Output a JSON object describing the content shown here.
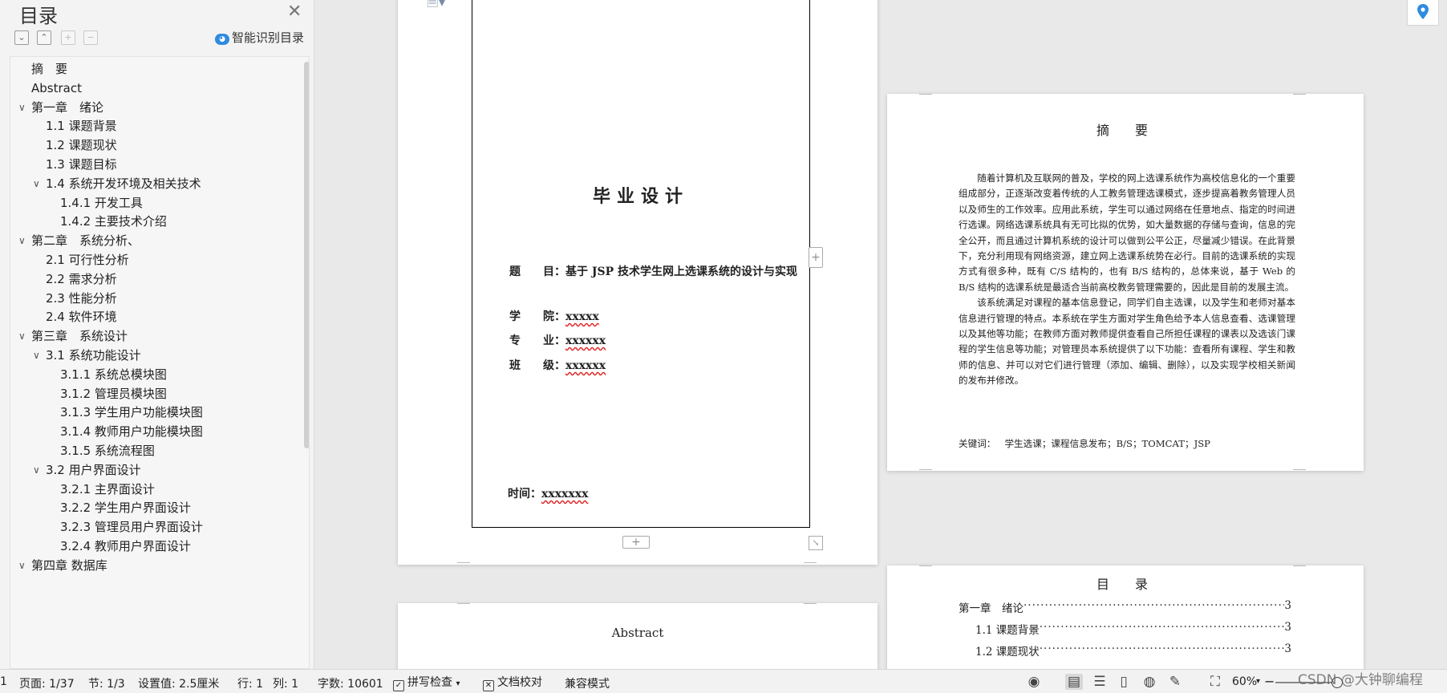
{
  "sidebar": {
    "title": "目录",
    "ai_toc_label": "智能识别目录",
    "ai_toc_icon": "cloud-ai-icon",
    "items": [
      {
        "label": "摘　要",
        "level": 0,
        "expanded": null
      },
      {
        "label": "Abstract",
        "level": 0,
        "expanded": null
      },
      {
        "label": "第一章　绪论",
        "level": 0,
        "expanded": true
      },
      {
        "label": "1.1 课题背景",
        "level": 1,
        "expanded": null
      },
      {
        "label": "1.2 课题现状",
        "level": 1,
        "expanded": null
      },
      {
        "label": "1.3 课题目标",
        "level": 1,
        "expanded": null
      },
      {
        "label": "1.4 系统开发环境及相关技术",
        "level": 1,
        "expanded": true
      },
      {
        "label": "1.4.1  开发工具",
        "level": 2,
        "expanded": null
      },
      {
        "label": "1.4.2 主要技术介绍",
        "level": 2,
        "expanded": null
      },
      {
        "label": "第二章　系统分析、",
        "level": 0,
        "expanded": true
      },
      {
        "label": "2.1 可行性分析",
        "level": 1,
        "expanded": null
      },
      {
        "label": "2.2 需求分析",
        "level": 1,
        "expanded": null
      },
      {
        "label": "2.3 性能分析",
        "level": 1,
        "expanded": null
      },
      {
        "label": "2.4 软件环境",
        "level": 1,
        "expanded": null
      },
      {
        "label": "第三章　系统设计",
        "level": 0,
        "expanded": true
      },
      {
        "label": "3.1 系统功能设计",
        "level": 1,
        "expanded": true
      },
      {
        "label": "3.1.1 系统总模块图",
        "level": 2,
        "expanded": null
      },
      {
        "label": "3.1.2 管理员模块图",
        "level": 2,
        "expanded": null
      },
      {
        "label": "3.1.3 学生用户功能模块图",
        "level": 2,
        "expanded": null
      },
      {
        "label": "3.1.4 教师用户功能模块图",
        "level": 2,
        "expanded": null
      },
      {
        "label": "3.1.5 系统流程图",
        "level": 2,
        "expanded": null
      },
      {
        "label": "3.2 用户界面设计",
        "level": 1,
        "expanded": true
      },
      {
        "label": "3.2.1 主界面设计",
        "level": 2,
        "expanded": null
      },
      {
        "label": "3.2.2 学生用户界面设计",
        "level": 2,
        "expanded": null
      },
      {
        "label": "3.2.3 管理员用户界面设计",
        "level": 2,
        "expanded": null
      },
      {
        "label": "3.2.4 教师用户界面设计",
        "level": 2,
        "expanded": null
      },
      {
        "label": "第四章  数据库",
        "level": 0,
        "expanded": true
      }
    ]
  },
  "cover": {
    "title": "毕业设计",
    "topic_label": "题　　目：",
    "topic_value": "基于 JSP 技术学生网上选课系统的设计与实现",
    "college_label": "学　　院：",
    "college_value": "xxxxx",
    "major_label": "专　　业：",
    "major_value": "xxxxxx",
    "class_label": "班　　级：",
    "class_value": "xxxxxx",
    "time_label": "时间：",
    "time_value": "xxxxxxx"
  },
  "abstract_cn": {
    "title": "摘　要",
    "p1": "随着计算机及互联网的普及，学校的网上选课系统作为高校信息化的一个重要组成部分，正逐渐改变着传统的人工教务管理选课模式，逐步提高着教务管理人员以及师生的工作效率。应用此系统，学生可以通过网络在任意地点、指定的时间进行选课。网络选课系统具有无可比拟的优势，如大量数据的存储与查询，信息的完全公开，而且通过计算机系统的设计可以做到公平公正，尽量减少错误。在此背景下，充分利用现有网络资源，建立网上选课系统势在必行。目前的选课系统的实现方式有很多种，既有 C/S 结构的，也有 B/S 结构的，总体来说，基于 Web 的 B/S 结构的选课系统是最适合当前高校教务管理需要的，因此是目前的发展主流。",
    "p2": "该系统满足对课程的基本信息登记，同学们自主选课，以及学生和老师对基本信息进行管理的特点。本系统在学生方面对学生角色给予本人信息查看、选课管理以及其他等功能；在教师方面对教师提供查看自己所担任课程的课表以及选该门课程的学生信息等功能；对管理员本系统提供了以下功能：查看所有课程、学生和教师的信息、并可以对它们进行管理（添加、编辑、删除），以及实现学校相关新闻的发布并修改。",
    "keywords_label": "关键词：",
    "keywords_value": "学生选课；课程信息发布；B/S；TOMCAT；JSP"
  },
  "abstract_en": {
    "title": "Abstract"
  },
  "toc_page": {
    "title": "目　录",
    "lines": [
      {
        "label": "第一章　绪论",
        "page": "3",
        "indent": 0
      },
      {
        "label": "1.1 课题背景",
        "page": "3",
        "indent": 1
      },
      {
        "label": "1.2 课题现状",
        "page": "3",
        "indent": 1
      }
    ]
  },
  "statusbar": {
    "page": "页面: 1/37",
    "section": "节: 1/3",
    "setting": "设置值: 2.5厘米",
    "row": "行: 1",
    "col": "列: 1",
    "words": "字数: 10601",
    "spell_check": "拼写检查",
    "doc_proof": "文档校对",
    "compat_mode": "兼容模式",
    "zoom": "60%"
  },
  "watermark": "CSDN @大钟聊编程",
  "colors": {
    "accent": "#2e8be0",
    "spell_underline": "#e02020"
  }
}
